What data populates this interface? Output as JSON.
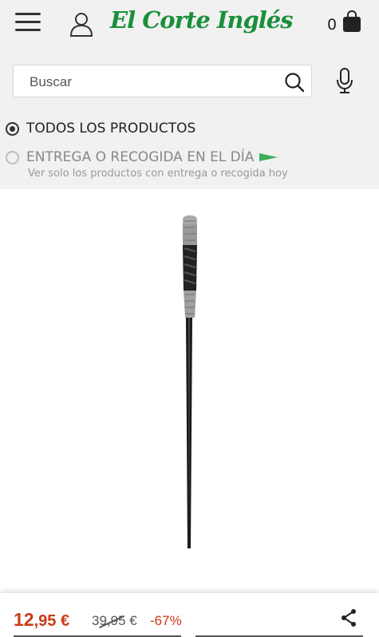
{
  "header": {
    "logo_text": "El Corte Inglés",
    "cart_count": "0",
    "icons": {
      "menu": "menu-icon",
      "user": "user-icon",
      "cart": "shopping-bag-icon"
    },
    "brand_color": "#1a8f3a"
  },
  "search": {
    "placeholder": "Buscar",
    "icons": {
      "search": "search-icon",
      "mic": "microphone-icon"
    }
  },
  "filters": {
    "options": [
      {
        "label": "TODOS LOS PRODUCTOS",
        "selected": true
      },
      {
        "label": "ENTREGA O RECOGIDA EN EL DÍA",
        "selected": false,
        "subtitle": "Ver solo los productos con entrega o recogida hoy",
        "icon": "flag-icon"
      }
    ]
  },
  "product": {
    "image": "magic-wand-image",
    "price_int": "12",
    "price_dec": ",95 €",
    "old_price_int": "39",
    "old_price_dec": ",95 €",
    "discount": "-67%",
    "price_color": "#cc3a15",
    "share_icon": "share-icon"
  }
}
